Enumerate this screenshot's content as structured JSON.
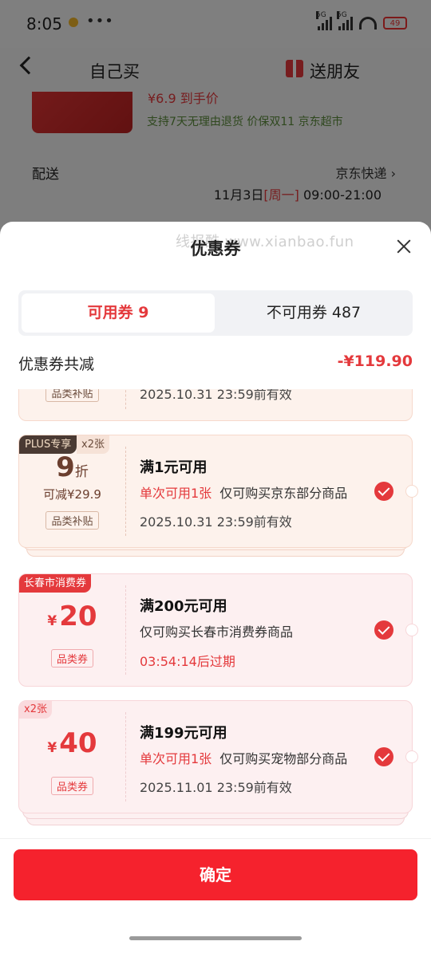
{
  "status_bar": {
    "time": "8:05",
    "dots": "•••",
    "sim1": "5G",
    "sim2": "5G",
    "battery": "49"
  },
  "nav": {
    "tab_self": "自己买",
    "tab_gift": "送朋友"
  },
  "product": {
    "price": "¥6.9 到手价",
    "services": "支持7天无理由退货  价保双11  京东超市"
  },
  "delivery": {
    "label": "配送",
    "method": "京东快递",
    "date": "11月3日",
    "weekday": "[周一]",
    "time": "09:00-21:00"
  },
  "sheet": {
    "watermark": "线报酷 www.xianbao.fun",
    "title": "优惠券",
    "tabs": {
      "usable": "可用券 9",
      "unusable": "不可用券 487"
    },
    "summary": {
      "label": "优惠券共减",
      "value": "-¥119.90"
    }
  },
  "coupons": [
    {
      "tag": "品类补贴",
      "time": "2025.10.31 23:59前有效"
    },
    {
      "badge": "PLUS专享",
      "count": "x2张",
      "value": "9",
      "unit": "折",
      "reduce": "可减¥29.9",
      "tag": "品类补贴",
      "title": "满1元可用",
      "limit": "单次可用1张",
      "rule": "仅可购买京东部分商品",
      "time": "2025.10.31 23:59前有效"
    },
    {
      "badge": "长春市消费券",
      "currency": "¥",
      "value": "20",
      "tag": "品类券",
      "title": "满200元可用",
      "rule": "仅可购买长春市消费券商品",
      "time": "03:54:14后过期"
    },
    {
      "count": "x2张",
      "currency": "¥",
      "value": "40",
      "tag": "品类券",
      "title": "满199元可用",
      "limit": "单次可用1张",
      "rule": "仅可购买宠物部分商品",
      "time": "2025.11.01 23:59前有效"
    }
  ],
  "footer": {
    "confirm": "确定"
  },
  "colors": {
    "accent": "#e4393c",
    "button": "#f5222d",
    "plus_badge": "#4a3a33"
  }
}
